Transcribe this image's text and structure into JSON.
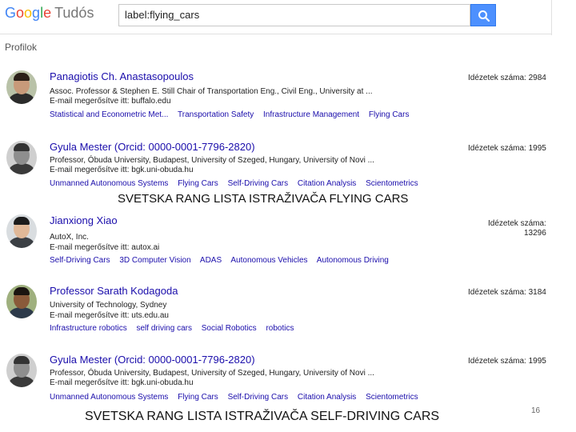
{
  "header": {
    "logo_letters": [
      "G",
      "o",
      "o",
      "g",
      "l",
      "e"
    ],
    "logo_suffix": "Tudós",
    "search_value": "label:flying_cars",
    "search_button_icon": "search-icon",
    "section_label": "Profilok"
  },
  "profiles": [
    {
      "name": "Panagiotis Ch. Anastasopoulos",
      "affiliation": "Assoc. Professor & Stephen E. Still Chair of Transportation Eng., Civil Eng., University at ...",
      "email": "E-mail megerősítve itt: buffalo.edu",
      "citations": "Idézetek száma: 2984",
      "tags": [
        "Statistical and Econometric Met...",
        "Transportation Safety",
        "Infrastructure Management",
        "Flying Cars"
      ]
    },
    {
      "name": "Gyula Mester (Orcid: 0000-0001-7796-2820)",
      "affiliation": "Professor, Óbuda University, Budapest, University of Szeged, Hungary, University of Novi ...",
      "email": "E-mail megerősítve itt: bgk.uni-obuda.hu",
      "citations": "Idézetek száma: 1995",
      "tags": [
        "Unmanned Autonomous Systems",
        "Flying Cars",
        "Self-Driving Cars",
        "Citation Analysis",
        "Scientometrics"
      ]
    },
    {
      "name": "Jianxiong Xiao",
      "affiliation": "AutoX, Inc.",
      "email": "E-mail megerősítve itt: autox.ai",
      "citations_label": "Idézetek száma:",
      "citations_value": "13296",
      "tags": [
        "Self-Driving Cars",
        "3D Computer Vision",
        "ADAS",
        "Autonomous Vehicles",
        "Autonomous Driving"
      ]
    },
    {
      "name": "Professor Sarath Kodagoda",
      "affiliation": "University of Technology, Sydney",
      "email": "E-mail megerősítve itt: uts.edu.au",
      "citations": "Idézetek száma: 3184",
      "tags": [
        "Infrastructure robotics",
        "self driving cars",
        "Social Robotics",
        "robotics"
      ]
    },
    {
      "name": "Gyula Mester (Orcid: 0000-0001-7796-2820)",
      "affiliation": "Professor, Óbuda University, Budapest, University of Szeged, Hungary, University of Novi ...",
      "email": "E-mail megerősítve itt: bgk.uni-obuda.hu",
      "citations": "Idézetek száma: 1995",
      "tags": [
        "Unmanned Autonomous Systems",
        "Flying Cars",
        "Self-Driving Cars",
        "Citation Analysis",
        "Scientometrics"
      ]
    }
  ],
  "captions": {
    "flying": "SVETSKA RANG LISTA ISTRAŽIVAČA FLYING CARS",
    "self_driving": "SVETSKA RANG LISTA ISTRAŽIVAČA SELF-DRIVING CARS"
  },
  "page_number": "16",
  "colors": {
    "link": "#1a0dab",
    "search_button": "#4d90fe"
  }
}
